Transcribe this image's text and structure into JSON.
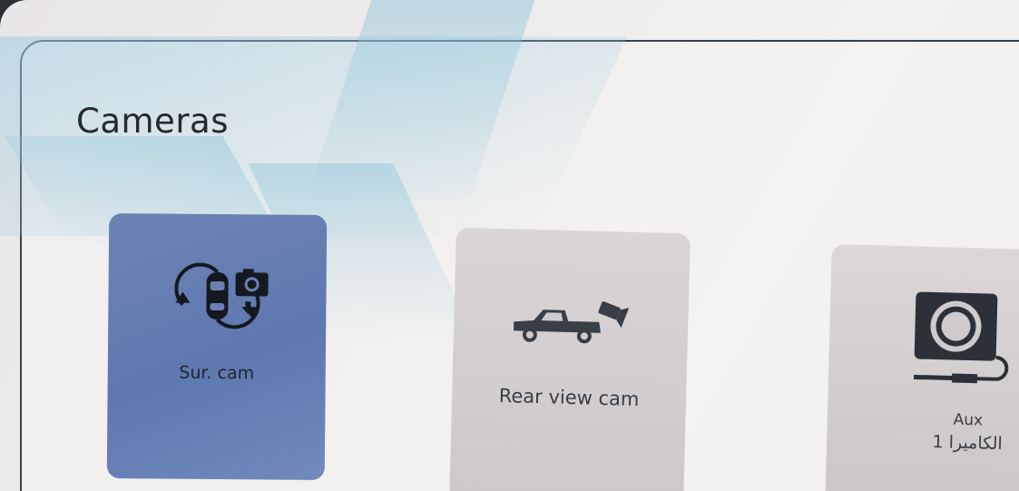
{
  "page": {
    "title": "Cameras"
  },
  "tiles": [
    {
      "id": "sur-cam",
      "label": "Sur. cam",
      "icon": "surround-camera-icon",
      "selected": true,
      "color": "#6279b0"
    },
    {
      "id": "rear-view-cam",
      "label": "Rear view cam",
      "icon": "rear-view-truck-camera-icon",
      "selected": false,
      "color": "#d3cfd0"
    },
    {
      "id": "aux-cam",
      "label": "Aux",
      "sublabel": "الكاميرا 1",
      "icon": "aux-camera-icon",
      "selected": false,
      "color": "#d3cfd0"
    }
  ]
}
